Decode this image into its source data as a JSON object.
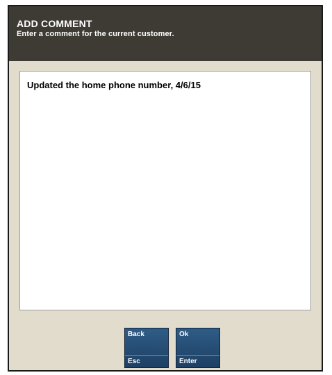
{
  "dialog": {
    "title": "ADD COMMENT",
    "subtitle": "Enter a comment for the current customer."
  },
  "comment": {
    "value": "Updated the home phone number, 4/6/15"
  },
  "buttons": {
    "back": {
      "label": "Back",
      "key": "Esc"
    },
    "ok": {
      "label": "Ok",
      "key": "Enter"
    }
  },
  "colors": {
    "header_bg": "#3e3b35",
    "dialog_bg": "#e2dccd",
    "button_bg": "#2a5580"
  }
}
